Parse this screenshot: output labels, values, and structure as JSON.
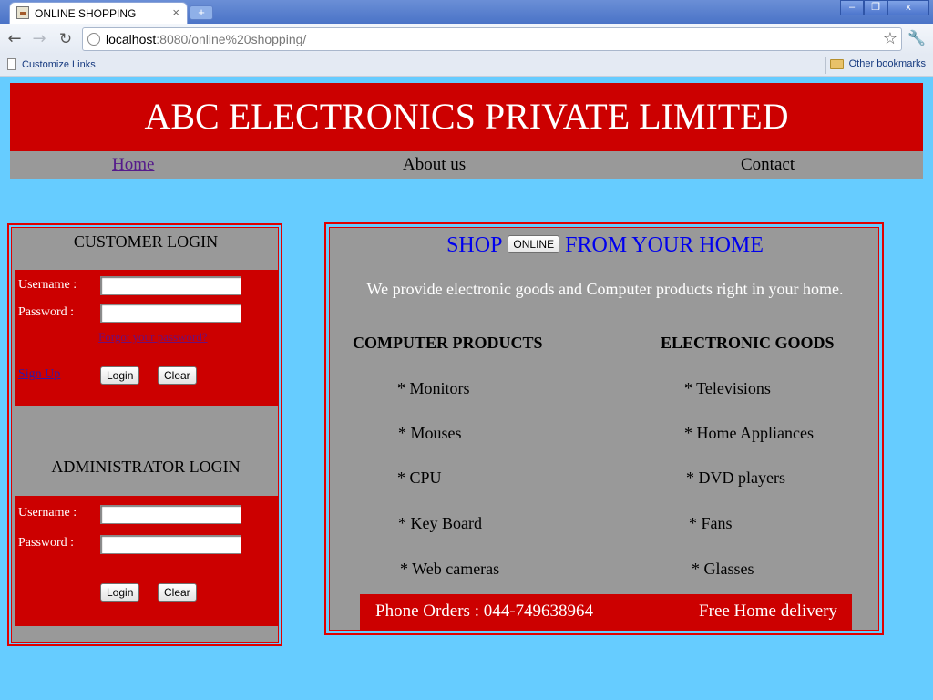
{
  "browser": {
    "tab_title": "ONLINE SHOPPING",
    "tab_close": "×",
    "new_tab": "+",
    "url_host": "localhost",
    "url_rest": ":8080/online%20shopping/",
    "bookmark_left": "Customize Links",
    "bookmark_right": "Other bookmarks",
    "window_buttons": [
      "–",
      "❐",
      "x"
    ]
  },
  "banner": {
    "title": "ABC ELECTRONICS PRIVATE LIMITED"
  },
  "nav": {
    "home": "Home",
    "about": "About us",
    "contact": "Contact"
  },
  "customer_login": {
    "title": "CUSTOMER LOGIN",
    "username_label": "Username :",
    "password_label": "Password :",
    "forgot": "Forgot your password?",
    "signup": "Sign Up",
    "login_button": "Login",
    "clear_button": "Clear"
  },
  "admin_login": {
    "title": "ADMINISTRATOR LOGIN",
    "username_label": "Username :",
    "password_label": "Password :",
    "login_button": "Login",
    "clear_button": "Clear"
  },
  "shop": {
    "head_before": "SHOP",
    "online_button": "ONLINE",
    "head_after": "FROM YOUR HOME",
    "tagline": "We provide electronic goods and Computer products right in your home.",
    "computer_heading": "COMPUTER PRODUCTS",
    "electronic_heading": "ELECTRONIC GOODS",
    "computer_items": [
      "* Monitors",
      "* Mouses",
      "* CPU",
      "* Key Board",
      "* Web cameras"
    ],
    "electronic_items": [
      "* Televisions",
      "* Home Appliances",
      "* DVD players",
      "* Fans",
      "* Glasses"
    ],
    "phone": "Phone Orders : 044-749638964",
    "delivery": "Free Home delivery"
  },
  "colors": {
    "banner": "#cc0000",
    "page_bg": "#66ccff",
    "panel": "#999999",
    "link_blue": "#0000ee"
  }
}
